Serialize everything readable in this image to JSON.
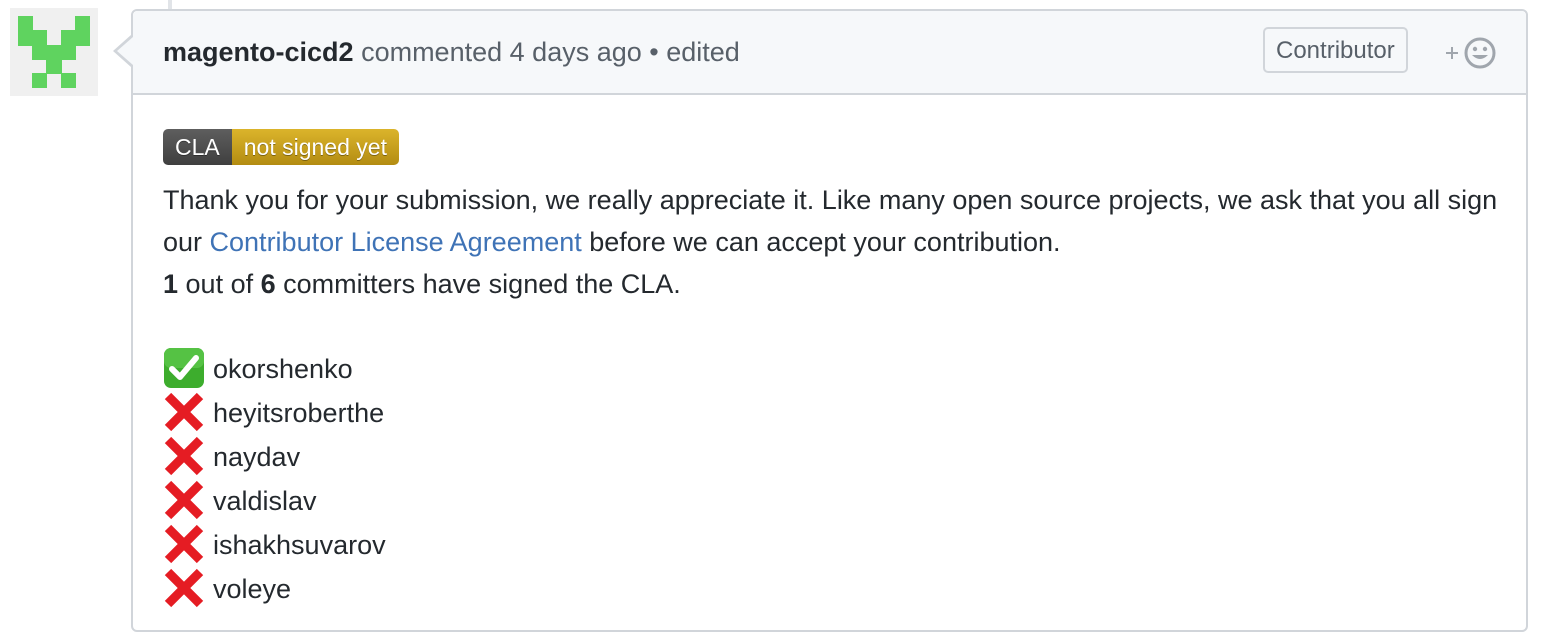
{
  "comment": {
    "author": "magento-cicd2",
    "action": "commented",
    "time": "4 days ago",
    "separator": "•",
    "edited": "edited",
    "role_badge": "Contributor",
    "reaction_icon": "smiley-add-icon"
  },
  "cla_badge": {
    "left": "CLA",
    "right": "not signed yet",
    "colors": {
      "left": "#4c4c4c",
      "right": "#c9a11d"
    }
  },
  "body": {
    "text_before_link": "Thank you for your submission, we really appreciate it. Like many open source projects, we ask that you all sign our ",
    "link_text": "Contributor License Agreement",
    "text_after_link": " before we can accept your contribution.",
    "signed_count": "1",
    "out_of_text": " out of ",
    "total_count": "6",
    "committers_text": " committers have signed the CLA."
  },
  "committers": [
    {
      "name": "okorshenko",
      "status": "signed",
      "icon": "check-icon"
    },
    {
      "name": "heyitsroberthe",
      "status": "not_signed",
      "icon": "cross-icon"
    },
    {
      "name": "naydav",
      "status": "not_signed",
      "icon": "cross-icon"
    },
    {
      "name": "valdislav",
      "status": "not_signed",
      "icon": "cross-icon"
    },
    {
      "name": "ishakhsuvarov",
      "status": "not_signed",
      "icon": "cross-icon"
    },
    {
      "name": "voleye",
      "status": "not_signed",
      "icon": "cross-icon"
    }
  ]
}
